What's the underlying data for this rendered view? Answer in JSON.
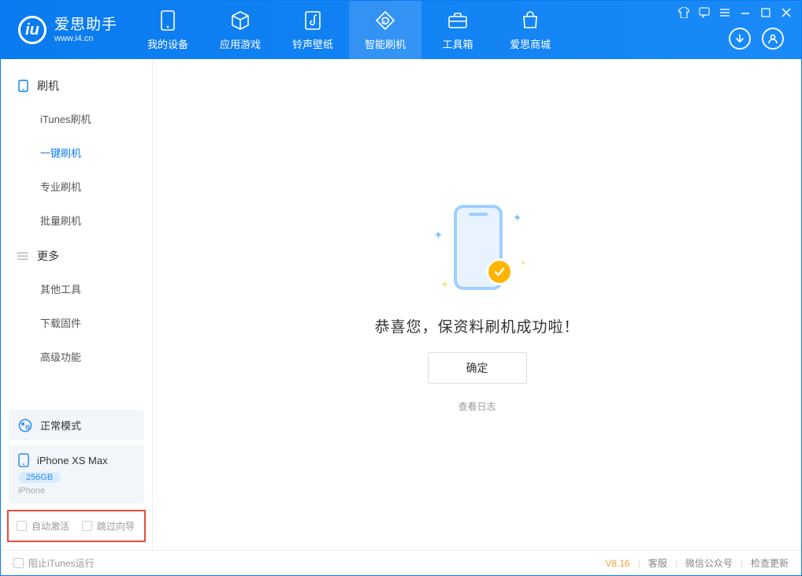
{
  "app": {
    "name": "爱思助手",
    "url": "www.i4.cn"
  },
  "nav": {
    "tabs": [
      {
        "label": "我的设备",
        "icon": "device-icon"
      },
      {
        "label": "应用游戏",
        "icon": "cube-icon"
      },
      {
        "label": "铃声壁纸",
        "icon": "music-icon"
      },
      {
        "label": "智能刷机",
        "icon": "refresh-icon"
      },
      {
        "label": "工具箱",
        "icon": "toolbox-icon"
      },
      {
        "label": "爱思商城",
        "icon": "shop-icon"
      }
    ],
    "active_index": 3
  },
  "sidebar": {
    "groups": [
      {
        "title": "刷机",
        "icon": "phone-icon",
        "items": [
          "iTunes刷机",
          "一键刷机",
          "专业刷机",
          "批量刷机"
        ],
        "active_index": 1
      },
      {
        "title": "更多",
        "icon": "more-icon",
        "items": [
          "其他工具",
          "下载固件",
          "高级功能"
        ],
        "active_index": -1
      }
    ],
    "mode": {
      "label": "正常模式"
    },
    "device": {
      "name": "iPhone XS Max",
      "storage": "256GB",
      "type": "iPhone"
    },
    "options": {
      "auto_activate": "自动激活",
      "skip_guide": "跳过向导"
    }
  },
  "main": {
    "success_message": "恭喜您，保资料刷机成功啦！",
    "ok_button": "确定",
    "view_log": "查看日志"
  },
  "statusbar": {
    "block_itunes": "阻止iTunes运行",
    "version": "V8.16",
    "links": [
      "客服",
      "微信公众号",
      "检查更新"
    ]
  },
  "colors": {
    "primary": "#0a7bf0",
    "accent": "#ffb400",
    "highlight_border": "#e74c3c"
  }
}
